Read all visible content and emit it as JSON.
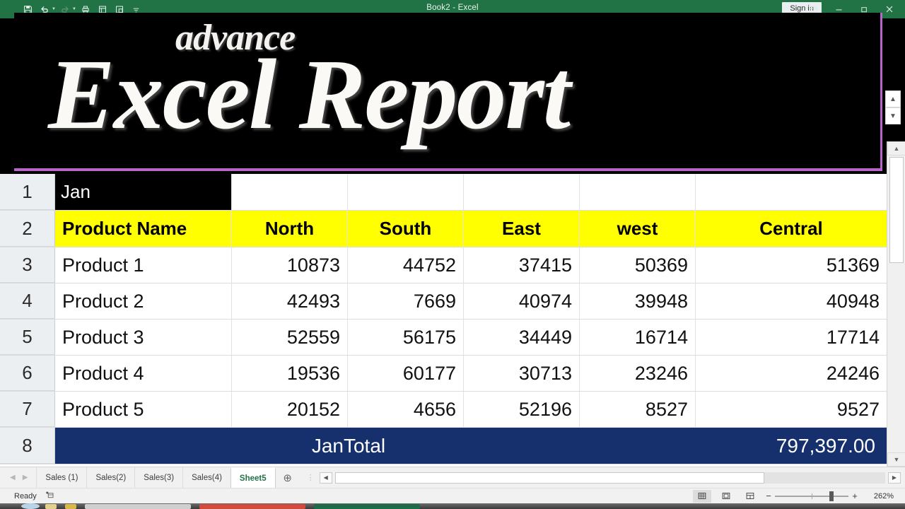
{
  "window": {
    "title": "Book2 - Excel",
    "signin_label": "Sign in",
    "ribbon_display_icon": "ribbon-display-options-icon",
    "minimize_icon": "minimize-icon",
    "restore_icon": "restore-icon",
    "close_icon": "close-icon"
  },
  "quick_access": {
    "items": [
      {
        "name": "save-icon",
        "label": "Save"
      },
      {
        "name": "undo-icon",
        "label": "Undo"
      },
      {
        "name": "redo-icon",
        "label": "Redo"
      },
      {
        "name": "quick-print-icon",
        "label": "Quick Print"
      },
      {
        "name": "print-preview-icon",
        "label": "Print Preview and Print"
      },
      {
        "name": "new-window-icon",
        "label": "New Window"
      },
      {
        "name": "customize-qat-icon",
        "label": "Customize Quick Access Toolbar"
      }
    ]
  },
  "banner": {
    "subtitle": "advance",
    "title": "Excel Report",
    "background_color": "#000000",
    "text_color": "#fbf9f5",
    "border_color": "#b864c8"
  },
  "sheet": {
    "row_headers": [
      "1",
      "2",
      "3",
      "4",
      "5",
      "6",
      "7",
      "8"
    ],
    "month_label": "Jan",
    "headers": [
      "Product Name",
      "North",
      "South",
      "East",
      "west",
      "Central"
    ],
    "rows": [
      {
        "name": "Product 1",
        "north": "10873",
        "south": "44752",
        "east": "37415",
        "west": "50369",
        "central": "51369"
      },
      {
        "name": "Product 2",
        "north": "42493",
        "south": "7669",
        "east": "40974",
        "west": "39948",
        "central": "40948"
      },
      {
        "name": "Product 3",
        "north": "52559",
        "south": "56175",
        "east": "34449",
        "west": "16714",
        "central": "17714"
      },
      {
        "name": "Product 4",
        "north": "19536",
        "south": "60177",
        "east": "30713",
        "west": "23246",
        "central": "24246"
      },
      {
        "name": "Product 5",
        "north": "20152",
        "south": "4656",
        "east": "52196",
        "west": "8527",
        "central": "9527"
      }
    ],
    "total": {
      "label": "JanTotal",
      "value": "797,397.00"
    },
    "colors": {
      "header_fill": "#ffff00",
      "month_fill": "#000000",
      "total_fill": "#15306c",
      "total_text": "#ffffff"
    }
  },
  "tabs": {
    "items": [
      {
        "label": "Sales (1)",
        "active": false
      },
      {
        "label": "Sales(2)",
        "active": false
      },
      {
        "label": "Sales(3)",
        "active": false
      },
      {
        "label": "Sales(4)",
        "active": false
      },
      {
        "label": "Sheet5",
        "active": true
      }
    ],
    "add_label": "+",
    "prev_icon": "chevron-left-icon",
    "next_icon": "chevron-right-icon"
  },
  "status": {
    "mode": "Ready",
    "macro_icon": "record-macro-icon",
    "views": [
      {
        "name": "normal-view-icon",
        "active": true
      },
      {
        "name": "page-layout-view-icon",
        "active": false
      },
      {
        "name": "page-break-preview-icon",
        "active": false
      }
    ],
    "zoom_out": "−",
    "zoom_in": "+",
    "zoom_level": "262%"
  },
  "scrollbars": {
    "v_up_icon": "scroll-up-icon",
    "v_down_icon": "scroll-down-icon",
    "h_left_icon": "scroll-left-icon",
    "h_right_icon": "scroll-right-icon",
    "collapse_up_icon": "chevron-up-icon",
    "collapse_down_icon": "chevron-down-icon"
  }
}
